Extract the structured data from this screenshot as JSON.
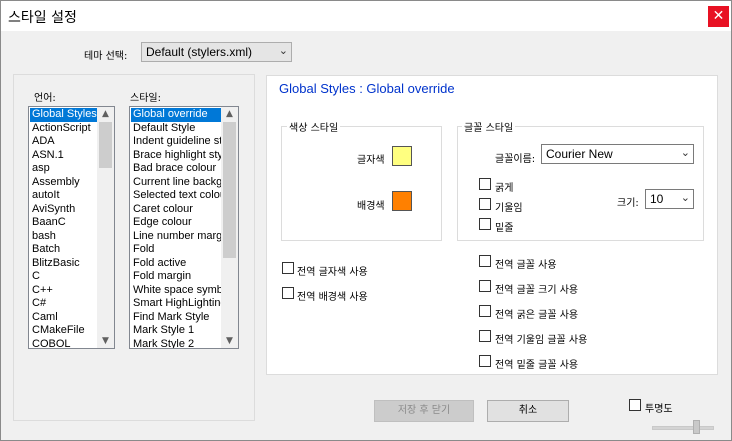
{
  "window": {
    "title": "스타일 설정",
    "close_glyph": "✕"
  },
  "theme": {
    "label": "테마 선택:",
    "selected": "Default (stylers.xml)"
  },
  "language": {
    "label": "언어:",
    "items": [
      "Global Styles",
      "ActionScript",
      "ADA",
      "ASN.1",
      "asp",
      "Assembly",
      "autoIt",
      "AviSynth",
      "BaanC",
      "bash",
      "Batch",
      "BlitzBasic",
      "C",
      "C++",
      "C#",
      "Caml",
      "CMakeFile",
      "COBOL"
    ],
    "selected_index": 0
  },
  "style": {
    "label": "스타일:",
    "items": [
      "Global override",
      "Default Style",
      "Indent guideline st",
      "Brace highlight styl",
      "Bad brace colour",
      "Current line backgr",
      "Selected text colou",
      "Caret colour",
      "Edge colour",
      "Line number marg",
      "Fold",
      "Fold active",
      "Fold margin",
      "White space symbo",
      "Smart HighLighting",
      "Find Mark Style",
      "Mark Style 1",
      "Mark Style 2"
    ],
    "selected_index": 0
  },
  "header": "Global Styles : Global override",
  "color_style": {
    "group_label": "색상 스타일",
    "fg_label": "글자색",
    "bg_label": "배경색",
    "fg_color": "#ffff80",
    "bg_color": "#ff8000"
  },
  "font_style": {
    "group_label": "글꼴 스타일",
    "name_label": "글꼴이름:",
    "name_value": "Courier New",
    "bold": "굵게",
    "italic": "기울임",
    "underline": "밑줄",
    "size_label": "크기:",
    "size_value": "10"
  },
  "global_options": {
    "fg": "전역 글자색 사용",
    "bg": "전역 배경색 사용",
    "font": "전역 글꼴 사용",
    "font_size": "전역 글꼴 크기 사용",
    "bold": "전역 굵은 글꼴 사용",
    "italic": "전역 기울임 글꼴 사용",
    "underline": "전역 밑줄 글꼴 사용"
  },
  "buttons": {
    "save_close": "저장 후 닫기",
    "cancel": "취소"
  },
  "transparency": {
    "label": "투명도"
  },
  "icons": {
    "dropdown": "chevron-down-icon",
    "close": "close-icon"
  },
  "colors": {
    "selection": "#0078d7",
    "close_button": "#e81123",
    "header_text": "#0033cc"
  }
}
